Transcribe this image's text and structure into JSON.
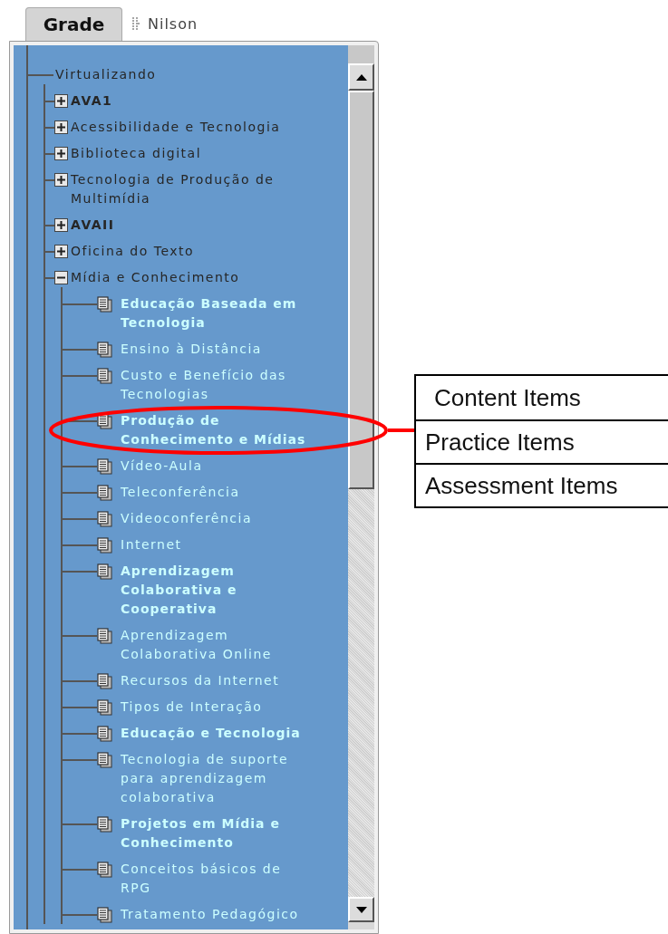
{
  "tabs": [
    {
      "label": "Grade",
      "selected": true
    },
    {
      "label": "Nilson",
      "selected": false
    }
  ],
  "tree": {
    "label": "Virtualizando",
    "children": [
      {
        "kind": "folder",
        "label": "AVA1",
        "expanded": false,
        "highlighted": true
      },
      {
        "kind": "folder",
        "label": "Acessibilidade e Tecnologia",
        "expanded": false,
        "highlighted": false
      },
      {
        "kind": "folder",
        "label": "Biblioteca digital",
        "expanded": false,
        "highlighted": false
      },
      {
        "kind": "folder",
        "label": "Tecnologia de Produção de Multimídia",
        "expanded": false,
        "highlighted": false
      },
      {
        "kind": "folder",
        "label": "AVAII",
        "expanded": false,
        "highlighted": true
      },
      {
        "kind": "folder",
        "label": "Oficina do Texto",
        "expanded": false,
        "highlighted": false
      },
      {
        "kind": "folder",
        "label": "Mídia e Conhecimento",
        "expanded": true,
        "highlighted": false,
        "children": [
          {
            "kind": "item",
            "label": "Educação Baseada em Tecnologia",
            "highlighted": true
          },
          {
            "kind": "item",
            "label": "Ensino à Distância",
            "highlighted": false
          },
          {
            "kind": "item",
            "label": "Custo e Benefício das Tecnologias",
            "highlighted": false
          },
          {
            "kind": "item",
            "label": "Produção de Conhecimento e Mídias",
            "highlighted": true
          },
          {
            "kind": "item",
            "label": "Vídeo-Aula",
            "highlighted": false
          },
          {
            "kind": "item",
            "label": "Teleconferência",
            "highlighted": false
          },
          {
            "kind": "item",
            "label": "Videoconferência",
            "highlighted": false
          },
          {
            "kind": "item",
            "label": "Internet",
            "highlighted": false
          },
          {
            "kind": "item",
            "label": "Aprendizagem Colaborativa e Cooperativa",
            "highlighted": true
          },
          {
            "kind": "item",
            "label": "Aprendizagem Colaborativa Online",
            "highlighted": false
          },
          {
            "kind": "item",
            "label": "Recursos da Internet",
            "highlighted": false
          },
          {
            "kind": "item",
            "label": "Tipos de Interação",
            "highlighted": false
          },
          {
            "kind": "item",
            "label": "Educação e Tecnologia",
            "highlighted": true
          },
          {
            "kind": "item",
            "label": "Tecnologia de suporte para aprendizagem colaborativa",
            "highlighted": false
          },
          {
            "kind": "item",
            "label": "Projetos em Mídia e Conhecimento",
            "highlighted": true
          },
          {
            "kind": "item",
            "label": "Conceitos básicos de RPG",
            "highlighted": false
          },
          {
            "kind": "item",
            "label": "Tratamento Pedagógico",
            "highlighted": false
          }
        ]
      }
    ]
  },
  "callout": {
    "items": [
      "Content Items",
      "Practice Items",
      "Assessment Items"
    ]
  }
}
